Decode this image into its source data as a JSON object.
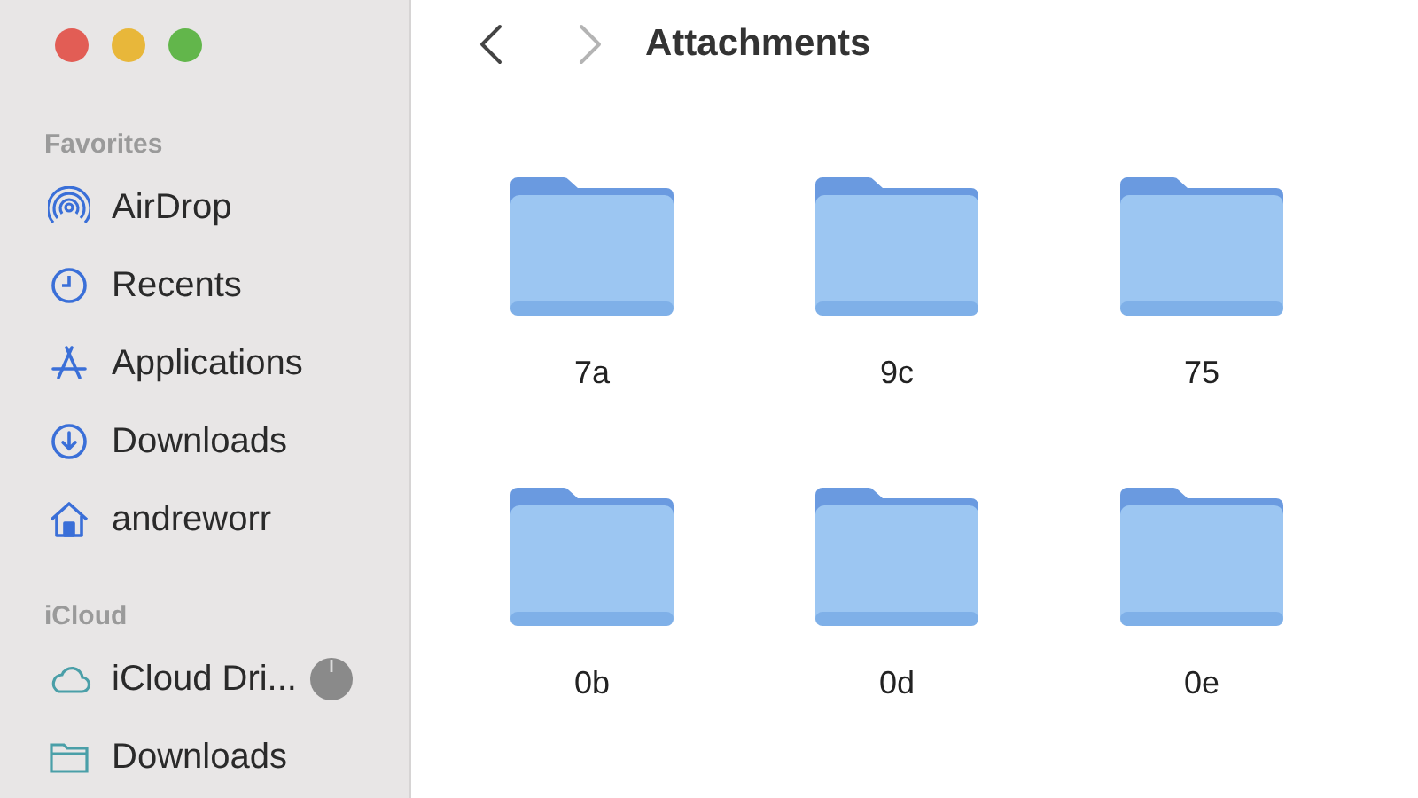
{
  "window": {
    "controls": [
      {
        "kind": "close"
      },
      {
        "kind": "minimize"
      },
      {
        "kind": "zoom"
      }
    ]
  },
  "sidebar": {
    "sections": [
      {
        "title": "Favorites",
        "items": [
          {
            "label": "AirDrop",
            "kind": "airdrop"
          },
          {
            "label": "Recents",
            "kind": "clock"
          },
          {
            "label": "Applications",
            "kind": "apps"
          },
          {
            "label": "Downloads",
            "kind": "download"
          },
          {
            "label": "andreworr",
            "kind": "home"
          }
        ]
      },
      {
        "title": "iCloud",
        "items": [
          {
            "label": "iCloud Dri...",
            "kind": "cloud",
            "syncing": true
          },
          {
            "label": "Downloads",
            "kind": "folder"
          }
        ]
      }
    ]
  },
  "toolbar": {
    "back": {
      "disabled": false
    },
    "forward": {
      "disabled": true
    },
    "title": "Attachments"
  },
  "files": [
    {
      "name": "7a"
    },
    {
      "name": "9c"
    },
    {
      "name": "75"
    },
    {
      "name": "0b"
    },
    {
      "name": "0d"
    },
    {
      "name": "0e"
    }
  ]
}
